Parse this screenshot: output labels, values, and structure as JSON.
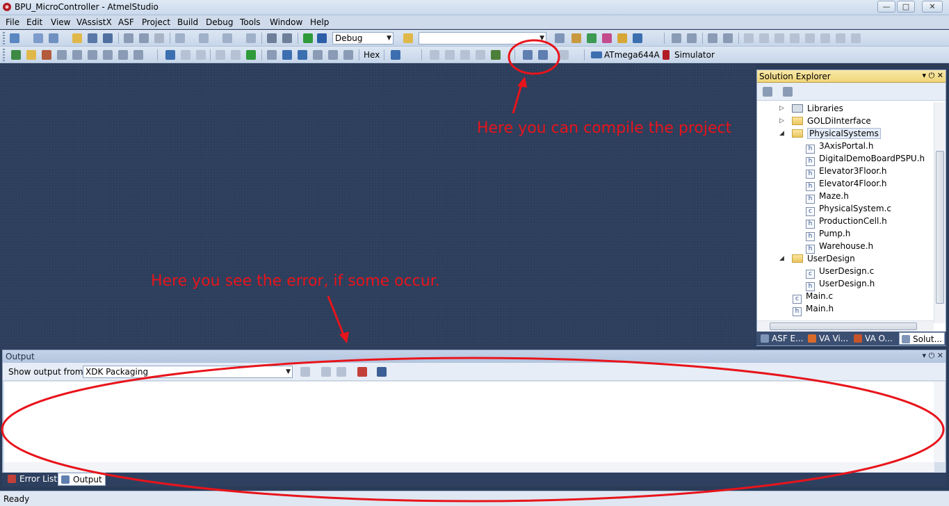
{
  "window": {
    "title": "BPU_MicroController - AtmelStudio"
  },
  "menu": [
    "File",
    "Edit",
    "View",
    "VAssistX",
    "ASF",
    "Project",
    "Build",
    "Debug",
    "Tools",
    "Window",
    "Help"
  ],
  "toolbar1": {
    "config": "Debug",
    "platform": ""
  },
  "toolbar2": {
    "hex": "Hex",
    "device": "ATmega644A",
    "tool": "Simulator"
  },
  "solution_explorer": {
    "title": "Solution Explorer",
    "items": [
      {
        "label": "Libraries",
        "type": "lib"
      },
      {
        "label": "GOLDiInterface",
        "type": "folder"
      },
      {
        "label": "PhysicalSystems",
        "type": "folder"
      },
      {
        "label": "3AxisPortal.h",
        "type": "h"
      },
      {
        "label": "DigitalDemoBoardPSPU.h",
        "type": "h"
      },
      {
        "label": "Elevator3Floor.h",
        "type": "h"
      },
      {
        "label": "Elevator4Floor.h",
        "type": "h"
      },
      {
        "label": "Maze.h",
        "type": "h"
      },
      {
        "label": "PhysicalSystem.c",
        "type": "c"
      },
      {
        "label": "ProductionCell.h",
        "type": "h"
      },
      {
        "label": "Pump.h",
        "type": "h"
      },
      {
        "label": "Warehouse.h",
        "type": "h"
      },
      {
        "label": "UserDesign",
        "type": "folder"
      },
      {
        "label": "UserDesign.c",
        "type": "c"
      },
      {
        "label": "UserDesign.h",
        "type": "h"
      },
      {
        "label": "Main.c",
        "type": "c"
      },
      {
        "label": "Main.h",
        "type": "h"
      }
    ],
    "tabs": [
      "ASF E...",
      "VA Vi...",
      "VA O...",
      "Solut..."
    ]
  },
  "output": {
    "title": "Output",
    "show_from_label": "Show output from:",
    "show_from_value": "XDK Packaging",
    "content": ""
  },
  "bottom_tabs": [
    "Error List",
    "Output"
  ],
  "status": "Ready",
  "annotations": {
    "compile_text": "Here you can compile the project",
    "error_text": "Here you see the error, if some occur."
  },
  "colors": {
    "annotation": "#e8141b",
    "editor_background": "#2c3e5c",
    "selection_tab": "#f1d779"
  }
}
